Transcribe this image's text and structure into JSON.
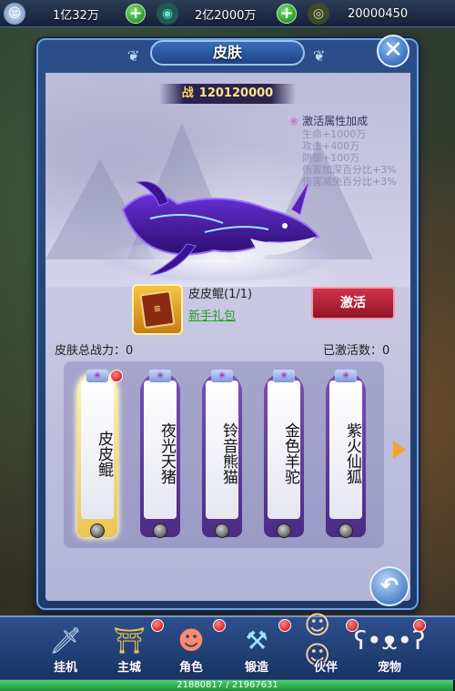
{
  "topbar": {
    "gold": "1亿32万",
    "silver": "2亿2000万",
    "currency3": "20000450"
  },
  "panel": {
    "title": "皮肤",
    "power_label": "战",
    "power_value": "120120000",
    "attr_title": "激活属性加成",
    "attributes": [
      "生命+1000万",
      "攻击+400万",
      "防御+100万",
      "伤害加深百分比+3%",
      "伤害减免百分比+3%"
    ],
    "skin_name": "皮皮鲲(1/1)",
    "skin_gift_link": "新手礼包",
    "activate_label": "激活",
    "total_power_text": "皮肤总战力：0",
    "activated_count_text": "已激活数：0"
  },
  "cards": [
    {
      "name": "皮皮鲲",
      "selected": true,
      "red_dot": true
    },
    {
      "name": "夜光天猪",
      "selected": false,
      "red_dot": false
    },
    {
      "name": "铃音熊猫",
      "selected": false,
      "red_dot": false
    },
    {
      "name": "金色羊驼",
      "selected": false,
      "red_dot": false
    },
    {
      "name": "紫火仙狐",
      "selected": false,
      "red_dot": false
    }
  ],
  "nav": [
    {
      "label": "挂机",
      "icon": "sword-icon"
    },
    {
      "label": "主城",
      "icon": "city-gate-icon"
    },
    {
      "label": "角色",
      "icon": "hero-portrait-icon"
    },
    {
      "label": "锻造",
      "icon": "hammer-icon"
    },
    {
      "label": "伙伴",
      "icon": "partners-icon"
    },
    {
      "label": "宠物",
      "icon": "panda-pet-icon"
    }
  ],
  "hp": {
    "text": "21880817 / 21967631",
    "fraction": 0.996
  },
  "colors": {
    "panel_blue": "#2b4e8a",
    "activate_red": "#d2324a",
    "gift_link_green": "#2a9a2a",
    "power_gold": "#ffe68a"
  }
}
